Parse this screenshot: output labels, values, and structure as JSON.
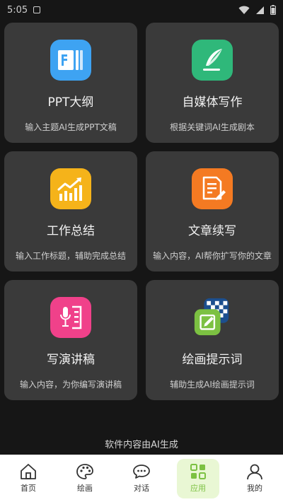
{
  "status_bar": {
    "time": "5:05"
  },
  "cards": [
    {
      "title": "PPT大纲",
      "desc": "输入主题AI生成PPT文稿",
      "icon": "ppt-icon",
      "color": "#3ea3f2"
    },
    {
      "title": "自媒体写作",
      "desc": "根据关键词AI生成剧本",
      "icon": "quill-icon",
      "color": "#2fb87a"
    },
    {
      "title": "工作总结",
      "desc": "输入工作标题，辅助完成总结",
      "icon": "chart-growth-icon",
      "color": "#f5b31a"
    },
    {
      "title": "文章续写",
      "desc": "输入内容，AI帮你扩写你的文章",
      "icon": "document-edit-icon",
      "color": "#f47a22"
    },
    {
      "title": "写演讲稿",
      "desc": "输入内容，为你编写演讲稿",
      "icon": "microphone-doc-icon",
      "color": "#f0418a"
    },
    {
      "title": "绘画提示词",
      "desc": "辅助生成AI绘画提示词",
      "icon": "paint-edit-icon",
      "color": "#7cc142"
    }
  ],
  "footer_note": "软件内容由AI生成",
  "tabs": [
    {
      "label": "首页",
      "icon": "home-icon"
    },
    {
      "label": "绘画",
      "icon": "palette-icon"
    },
    {
      "label": "对话",
      "icon": "chat-icon"
    },
    {
      "label": "应用",
      "icon": "apps-icon",
      "active": true
    },
    {
      "label": "我的",
      "icon": "person-icon"
    }
  ]
}
